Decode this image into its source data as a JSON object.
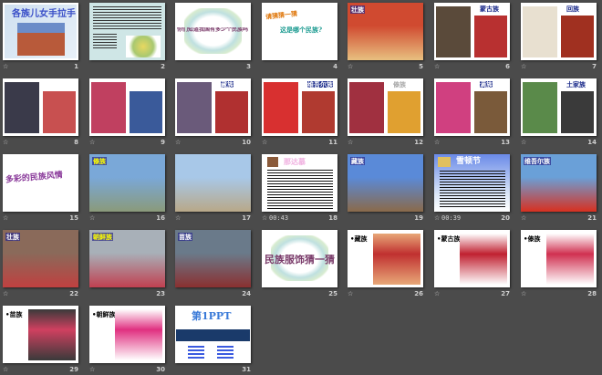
{
  "view": "slide-sorter",
  "slides": [
    {
      "n": "1",
      "star": true,
      "title": "各族儿女手拉手",
      "tcolor": "#3a4fc8",
      "bg": "#ffffff",
      "photo": [
        "#b85a3a",
        "#6b8cc8"
      ],
      "layout": "title-photo"
    },
    {
      "n": "2",
      "star": false,
      "title": "",
      "bg": "#cfe6e6",
      "layout": "text-map"
    },
    {
      "n": "3",
      "star": false,
      "title": "你们知道我国有多少个民族吗？",
      "tcolor": "#7a3b6a",
      "bg": "#ffffff",
      "layout": "frame"
    },
    {
      "n": "4",
      "star": false,
      "title": "请猜猜一猜",
      "title2": "这是哪个民族?",
      "tcolor": "#e07a10",
      "tcolor2": "#1a9a90",
      "bg": "#ffffff",
      "layout": "two-text"
    },
    {
      "n": "5",
      "star": true,
      "title": "壮族",
      "tcolor": "#ffffff",
      "bg": "#c83020",
      "photo": [
        "#d04a30",
        "#e8c080"
      ],
      "layout": "full-photo"
    },
    {
      "n": "6",
      "star": true,
      "title": "蒙古族",
      "tcolor": "#1a2a8a",
      "bg": "#ffffff",
      "photo": [
        "#5a4a3a",
        "#b83030"
      ],
      "layout": "two-photo"
    },
    {
      "n": "7",
      "star": true,
      "title": "回族",
      "tcolor": "#1a2a8a",
      "bg": "#ffffff",
      "photo": [
        "#e8e0d0",
        "#a03020"
      ],
      "layout": "two-photo"
    },
    {
      "n": "8",
      "star": true,
      "title": "",
      "bg": "#ffffff",
      "photo": [
        "#3a3a4a",
        "#c85050"
      ],
      "layout": "two-photo"
    },
    {
      "n": "9",
      "star": true,
      "title": "",
      "bg": "#ffffff",
      "photo": [
        "#c04060",
        "#3a5a9a"
      ],
      "layout": "two-photo"
    },
    {
      "n": "10",
      "star": true,
      "title": "藏族",
      "tcolor": "#ffffff",
      "bg": "#ffffff",
      "photo": [
        "#6a5a7a",
        "#b03030"
      ],
      "layout": "two-photo"
    },
    {
      "n": "11",
      "star": true,
      "title": "维吾尔族",
      "tcolor": "#ffffff",
      "bg": "#ffffff",
      "photo": [
        "#d83030",
        "#b03a30"
      ],
      "layout": "two-photo"
    },
    {
      "n": "12",
      "star": true,
      "title": "傣族",
      "tcolor": "#aaaaaa",
      "bg": "#ffffff",
      "photo": [
        "#a03040",
        "#e0a030"
      ],
      "layout": "two-photo"
    },
    {
      "n": "13",
      "star": true,
      "title": "满族",
      "tcolor": "#ffffff",
      "bg": "#ffffff",
      "photo": [
        "#d04080",
        "#7a5a3a"
      ],
      "layout": "two-photo"
    },
    {
      "n": "14",
      "star": true,
      "title": "土家族",
      "tcolor": "#1a2a8a",
      "bg": "#ffffff",
      "photo": [
        "#5a8a4a",
        "#3a3a3a"
      ],
      "layout": "two-photo"
    },
    {
      "n": "15",
      "star": true,
      "title": "多彩的民族风情",
      "tcolor": "#8a3a9a",
      "bg": "#ffffff",
      "layout": "big-text"
    },
    {
      "n": "16",
      "star": true,
      "title": "傣族",
      "tcolor": "#ffff00",
      "bg": "#6a9ac8",
      "photo": [
        "#7aa8d8",
        "#8a9a7a"
      ],
      "layout": "full-photo"
    },
    {
      "n": "17",
      "star": true,
      "title": "",
      "bg": "#9ab8d8",
      "photo": [
        "#a8c8e8",
        "#b8a888"
      ],
      "layout": "full-photo"
    },
    {
      "n": "18",
      "star": true,
      "time": "00:43",
      "title": "那达慕",
      "tcolor": "#f0b0e0",
      "bg": "#ffffff",
      "layout": "text-doc"
    },
    {
      "n": "19",
      "star": false,
      "title": "藏族",
      "tcolor": "#ffffff",
      "bg": "#5a8ad8",
      "photo": [
        "#5a8ad8",
        "#8a6a4a"
      ],
      "layout": "full-photo"
    },
    {
      "n": "20",
      "star": true,
      "time": "00:39",
      "title": "雪顿节",
      "tcolor": "#ffffff",
      "bg": "#3a6ac8",
      "layout": "text-doc-blue"
    },
    {
      "n": "21",
      "star": true,
      "title": "维吾尔族",
      "tcolor": "#ffffff",
      "bg": "#d84020",
      "photo": [
        "#6aa0d8",
        "#d83020"
      ],
      "layout": "full-photo"
    },
    {
      "n": "22",
      "star": true,
      "title": "壮族",
      "tcolor": "#ffffff",
      "bg": "#a06a4a",
      "photo": [
        "#8a6a5a",
        "#c04040"
      ],
      "layout": "full-photo"
    },
    {
      "n": "23",
      "star": false,
      "title": "朝鲜族",
      "tcolor": "#ffff00",
      "bg": "#8a9aa8",
      "photo": [
        "#a8b0b8",
        "#c04050"
      ],
      "layout": "full-photo"
    },
    {
      "n": "24",
      "star": false,
      "title": "苗族",
      "tcolor": "#ffffff",
      "bg": "#5a6a5a",
      "photo": [
        "#6a7a8a",
        "#8a3030"
      ],
      "layout": "full-photo"
    },
    {
      "n": "25",
      "star": false,
      "title": "民族服饰猜一猜",
      "tcolor": "#7a3b6a",
      "bg": "#ffffff",
      "layout": "frame"
    },
    {
      "n": "26",
      "star": true,
      "title": "•藏族",
      "tcolor": "#000000",
      "bg": "#ffffff",
      "photo": [
        "#e8a878",
        "#c03030"
      ],
      "layout": "bullet-photo"
    },
    {
      "n": "27",
      "star": true,
      "title": "•蒙古族",
      "tcolor": "#000000",
      "bg": "#ffffff",
      "photo": [
        "#ffffff",
        "#c02030"
      ],
      "layout": "bullet-photo"
    },
    {
      "n": "28",
      "star": true,
      "title": "•傣族",
      "tcolor": "#000000",
      "bg": "#ffffff",
      "photo": [
        "#ffffff",
        "#d03050"
      ],
      "layout": "bullet-photo"
    },
    {
      "n": "29",
      "star": true,
      "title": "•苗族",
      "tcolor": "#000000",
      "bg": "#ffffff",
      "photo": [
        "#3a3a3a",
        "#d04060"
      ],
      "layout": "bullet-photo"
    },
    {
      "n": "30",
      "star": true,
      "title": "•朝鲜族",
      "tcolor": "#000000",
      "bg": "#ffffff",
      "photo": [
        "#ffffff",
        "#e03080"
      ],
      "layout": "bullet-photo"
    },
    {
      "n": "31",
      "star": false,
      "title": "第1PPT",
      "tcolor": "#3a7ad8",
      "bg": "#ffffff",
      "layout": "brand"
    }
  ],
  "icons": {
    "star": "☆"
  }
}
